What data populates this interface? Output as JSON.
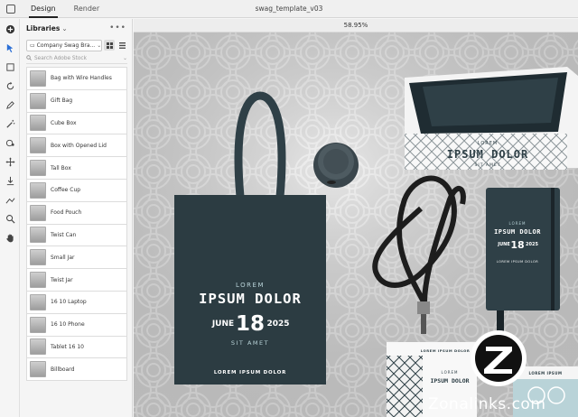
{
  "topbar": {
    "tabs": [
      {
        "label": "Design",
        "active": true
      },
      {
        "label": "Render",
        "active": false
      }
    ],
    "document_title": "swag_template_v03"
  },
  "toolbar": {
    "tools": [
      "add-icon",
      "select-icon",
      "frame-icon",
      "rotate-icon",
      "pen-icon",
      "magic-wand-icon",
      "paint-icon",
      "move-icon",
      "download-icon",
      "measure-icon",
      "zoom-icon",
      "hand-icon"
    ]
  },
  "libraries": {
    "title": "Libraries",
    "more_label": "•••",
    "selected_library": "Company Swag Bra...",
    "search_placeholder": "Search Adobe Stock",
    "items": [
      {
        "label": "Bag with Wire Handles"
      },
      {
        "label": "Gift Bag"
      },
      {
        "label": "Cube Box"
      },
      {
        "label": "Box with Opened Lid"
      },
      {
        "label": "Tall Box"
      },
      {
        "label": "Coffee Cup"
      },
      {
        "label": "Food Pouch"
      },
      {
        "label": "Twist Can"
      },
      {
        "label": "Small Jar"
      },
      {
        "label": "Twist Jar"
      },
      {
        "label": "16 10 Laptop"
      },
      {
        "label": "16 10 Phone"
      },
      {
        "label": "Tablet 16 10"
      },
      {
        "label": "Billboard"
      }
    ]
  },
  "canvas": {
    "zoom": "58.95%",
    "tote": {
      "lorem": "LOREM",
      "headline": "IPSUM DOLOR",
      "month": "JUNE",
      "day": "18",
      "year": "2025",
      "sit_amet": "SIT AMET",
      "footer": "LOREM IPSUM DOLOR"
    },
    "bag": {
      "lorem": "LOREM",
      "headline": "IPSUM DOLOR",
      "sub": "SIT AMET"
    },
    "notebook": {
      "lorem": "LOREM",
      "headline": "IPSUM DOLOR",
      "month": "JUNE",
      "day": "18",
      "year": "2025",
      "footer": "LOREM IPSUM DOLOR"
    },
    "badge": {
      "top": "LOREM IPSUM DOLOR",
      "lorem": "LOREM",
      "headline": "IPSUM DOLOR"
    },
    "card": {
      "line": "LOREM IPSUM"
    },
    "product_color": "#2f4047",
    "accent_color": "#b9d3d8"
  },
  "watermark": {
    "text": "Zonalinks.com"
  }
}
